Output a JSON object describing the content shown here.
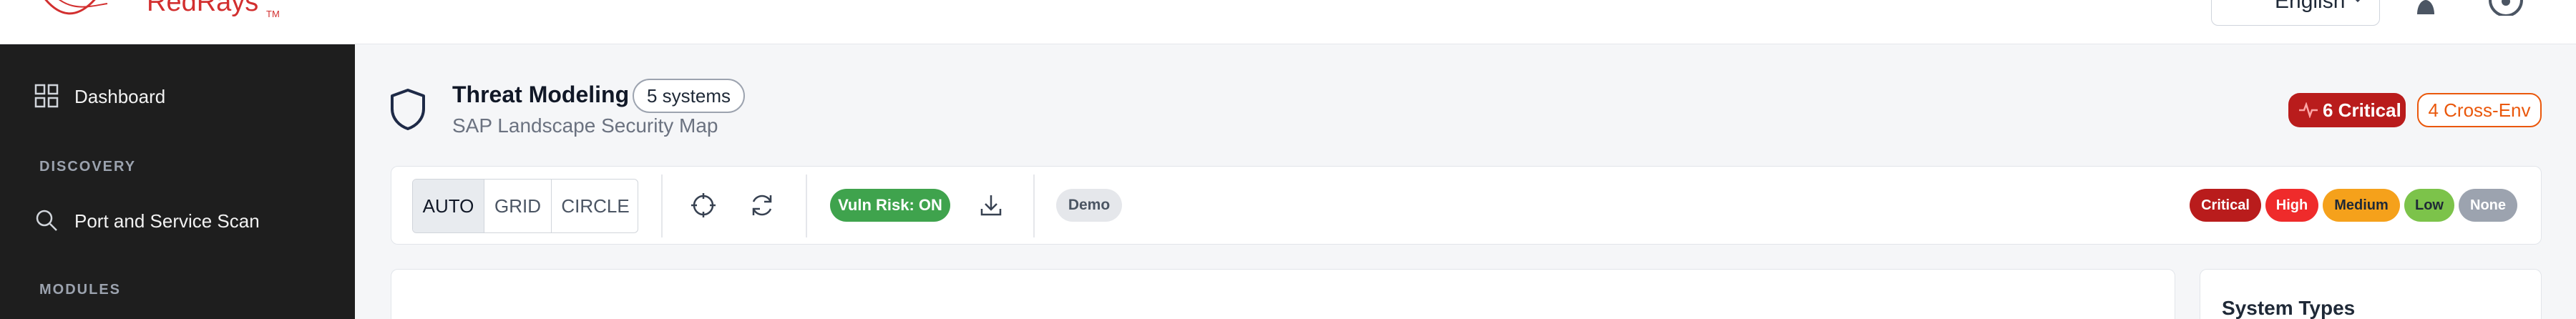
{
  "header": {
    "logo_text": "RedRays",
    "logo_tm": "TM",
    "language": "English"
  },
  "sidebar": {
    "dashboard": "Dashboard",
    "section_discovery": "DISCOVERY",
    "port_scan": "Port and Service Scan",
    "section_modules": "MODULES"
  },
  "page": {
    "title": "Threat Modeling",
    "systems_count": "5 systems",
    "subtitle": "SAP Landscape Security Map",
    "critical_badge": "6 Critical",
    "cross_env_badge": "4 Cross-Env"
  },
  "toolbar": {
    "layout_modes": [
      "AUTO",
      "GRID",
      "CIRCLE"
    ],
    "active_mode": "AUTO",
    "vuln_risk": "Vuln Risk: ON",
    "demo": "Demo",
    "legend": [
      {
        "label": "Critical",
        "color": "#b91c1c"
      },
      {
        "label": "High",
        "color": "#ef2b2b"
      },
      {
        "label": "Medium",
        "color": "#f5a11b"
      },
      {
        "label": "Low",
        "color": "#7cc34a"
      },
      {
        "label": "None",
        "color": "#9ca3af"
      }
    ]
  },
  "panels": {
    "system_types_title": "System Types"
  },
  "colors": {
    "brand": "#d22f2f",
    "sidebar_bg": "#1e1e1e",
    "accent_navy": "#1e2a47",
    "vuln_on": "#3fa34d",
    "cross_env": "#ea580c"
  }
}
